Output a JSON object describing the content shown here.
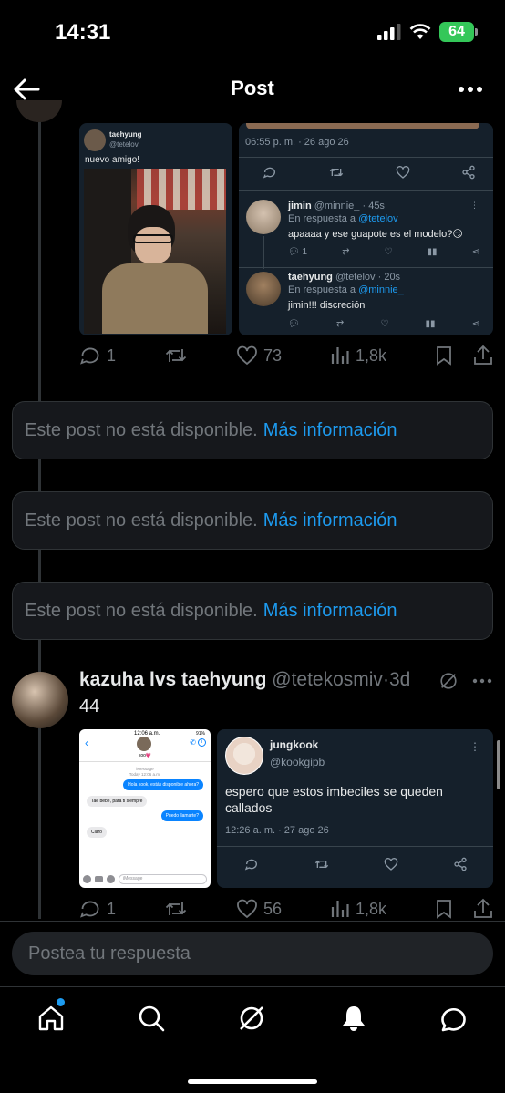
{
  "status_bar": {
    "time": "14:31",
    "battery": "64"
  },
  "header": {
    "title": "Post"
  },
  "post1": {
    "left_card": {
      "name": "taehyung",
      "handle": "@tetelov",
      "text": "nuevo amigo!"
    },
    "right_card": {
      "timestamp": "06:55 p. m. · 26 ago 26",
      "reply1": {
        "name": "jimin",
        "handle_time": "@minnie_ · 45s",
        "in_reply_prefix": "En respuesta a",
        "in_reply_to": "@tetelov",
        "text": "apaaaa y ese guapote es el modelo?😏",
        "count": "1"
      },
      "reply2": {
        "name": "taehyung",
        "handle_time": "@tetelov · 20s",
        "in_reply_prefix": "En respuesta a",
        "in_reply_to": "@minnie_",
        "text": "jimin!!! discreción"
      }
    },
    "stats": {
      "replies": "1",
      "likes": "73",
      "views": "1,8k"
    }
  },
  "unavailable": {
    "text": "Este post no está disponible.",
    "link": "Más información"
  },
  "post2": {
    "author": "kazuha lvs taehyung",
    "handle": "@tetekosmiv",
    "time": "3d",
    "text": "44",
    "imessage": {
      "time": "12:06 a.m.",
      "battery": "91%",
      "contact": "koo💗",
      "header_small": "iMessage",
      "date_small": "Today 12:06 a.m.",
      "bubbles": [
        {
          "side": "right",
          "text": "Hola kook, estás disponible ahora?"
        },
        {
          "side": "left",
          "text": "Tae bebé, para ti siempre"
        },
        {
          "side": "right",
          "text": "Puedo llamarte?"
        },
        {
          "side": "left",
          "text": "Claro"
        }
      ],
      "input_placeholder": "iMessage"
    },
    "quote": {
      "name": "jungkook",
      "handle": "@kookgipb",
      "text": "espero que estos imbeciles se queden callados",
      "timestamp": "12:26 a. m. · 27 ago 26"
    },
    "stats": {
      "replies": "1",
      "likes": "56",
      "views": "1,8k"
    }
  },
  "reply_bar": {
    "placeholder": "Postea tu respuesta"
  },
  "colors": {
    "accent": "#1d9bf0",
    "background": "#000000",
    "card": "#15202b",
    "muted": "#71767b"
  },
  "icons": [
    "back-arrow",
    "more-horizontal",
    "reply",
    "retweet",
    "like",
    "views",
    "bookmark",
    "share",
    "grok",
    "home",
    "search",
    "notifications",
    "messages"
  ]
}
